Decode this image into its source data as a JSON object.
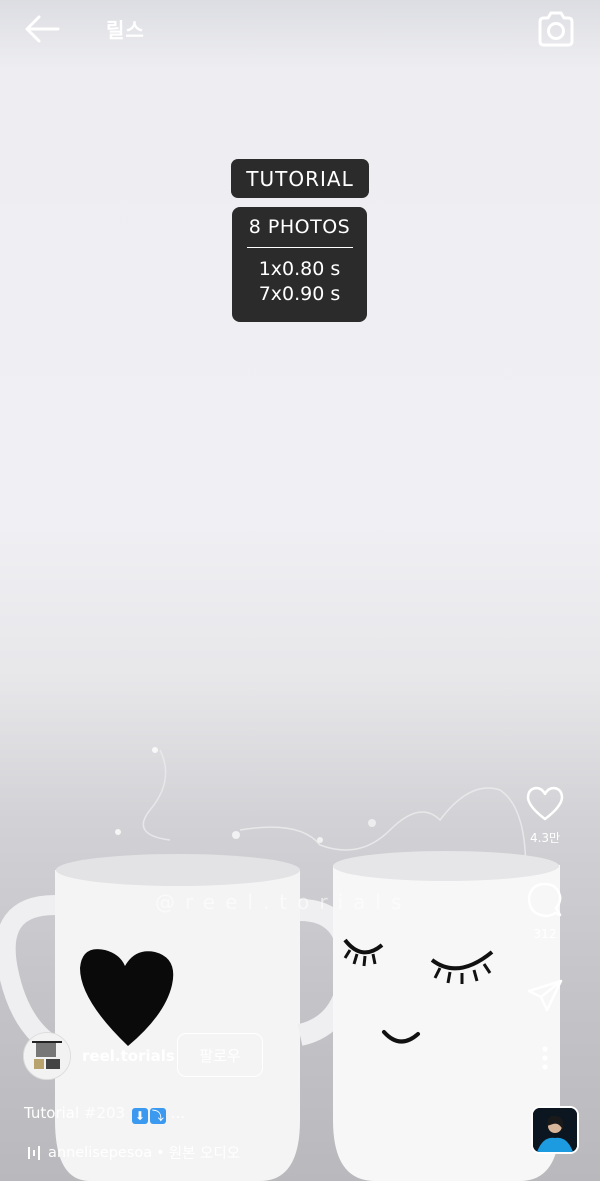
{
  "header": {
    "title": "릴스",
    "back_icon": "back-arrow-icon",
    "camera_icon": "camera-icon"
  },
  "overlay": {
    "label": "TUTORIAL",
    "photo_count": "8  PHOTOS",
    "lines": [
      "1x0.80 s",
      "7x0.90 s"
    ]
  },
  "watermark": "@reel.torials",
  "actions": {
    "like_count": "4.3만",
    "comment_count": "312"
  },
  "profile": {
    "username": "reel.torials",
    "follow_label": "팔로우"
  },
  "caption": {
    "text": "Tutorial ",
    "tag": "#203",
    "emoji1": "⬇",
    "emoji2": "⤵",
    "more": "..."
  },
  "audio": {
    "artist": "annelisepesoa",
    "separator": "•",
    "label": "원본 오디오"
  },
  "colors": {
    "overlay_bg": "#2b2b2b",
    "text_white": "#ffffff",
    "emoji_blue": "#3b9af0"
  }
}
